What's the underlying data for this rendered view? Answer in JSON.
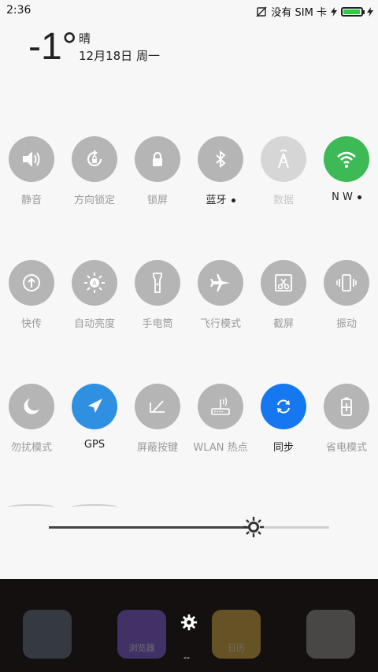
{
  "status_bar": {
    "time": "2:36",
    "sim_text": "没有 SIM 卡",
    "battery_level": 0.95
  },
  "weather": {
    "temperature": "-1°",
    "condition": "晴",
    "date": "12月18日 周一"
  },
  "tiles": [
    {
      "label": "静音",
      "icon": "speaker-icon"
    },
    {
      "label": "方向锁定",
      "icon": "rotation-lock-icon"
    },
    {
      "label": "锁屏",
      "icon": "lock-icon"
    },
    {
      "label": "蓝牙",
      "icon": "bluetooth-icon"
    },
    {
      "label": "数据",
      "icon": "cell-tower-icon"
    },
    {
      "label": "N  W",
      "icon": "wifi-icon"
    },
    {
      "label": "快传",
      "icon": "quick-transfer-icon"
    },
    {
      "label": "自动亮度",
      "icon": "auto-brightness-icon"
    },
    {
      "label": "手电筒",
      "icon": "flashlight-icon"
    },
    {
      "label": "飞行模式",
      "icon": "airplane-icon"
    },
    {
      "label": "截屏",
      "icon": "screenshot-icon"
    },
    {
      "label": "振动",
      "icon": "vibrate-icon"
    },
    {
      "label": "勿扰模式",
      "icon": "moon-icon"
    },
    {
      "label": "GPS",
      "icon": "gps-icon"
    },
    {
      "label": "屏蔽按键",
      "icon": "block-keys-icon"
    },
    {
      "label": "WLAN 热点",
      "icon": "hotspot-icon"
    },
    {
      "label": "同步",
      "icon": "sync-icon"
    },
    {
      "label": "省电模式",
      "icon": "battery-saver-icon"
    }
  ],
  "brightness": {
    "level": 0.73
  },
  "dock": {
    "apps": [
      {
        "label": "",
        "icon": "app-icon"
      },
      {
        "label": "浏览器",
        "icon": "browser-icon"
      },
      {
        "label": "日历",
        "icon": "calendar-icon"
      },
      {
        "label": "",
        "icon": "camera-icon"
      }
    ],
    "page_indicator": "--"
  },
  "colors": {
    "tile_default": "#b5b5b5",
    "tile_active_wifi": "#3dba55",
    "tile_active_gps": "#2f8fe0",
    "tile_active_sync": "#1678f0"
  }
}
